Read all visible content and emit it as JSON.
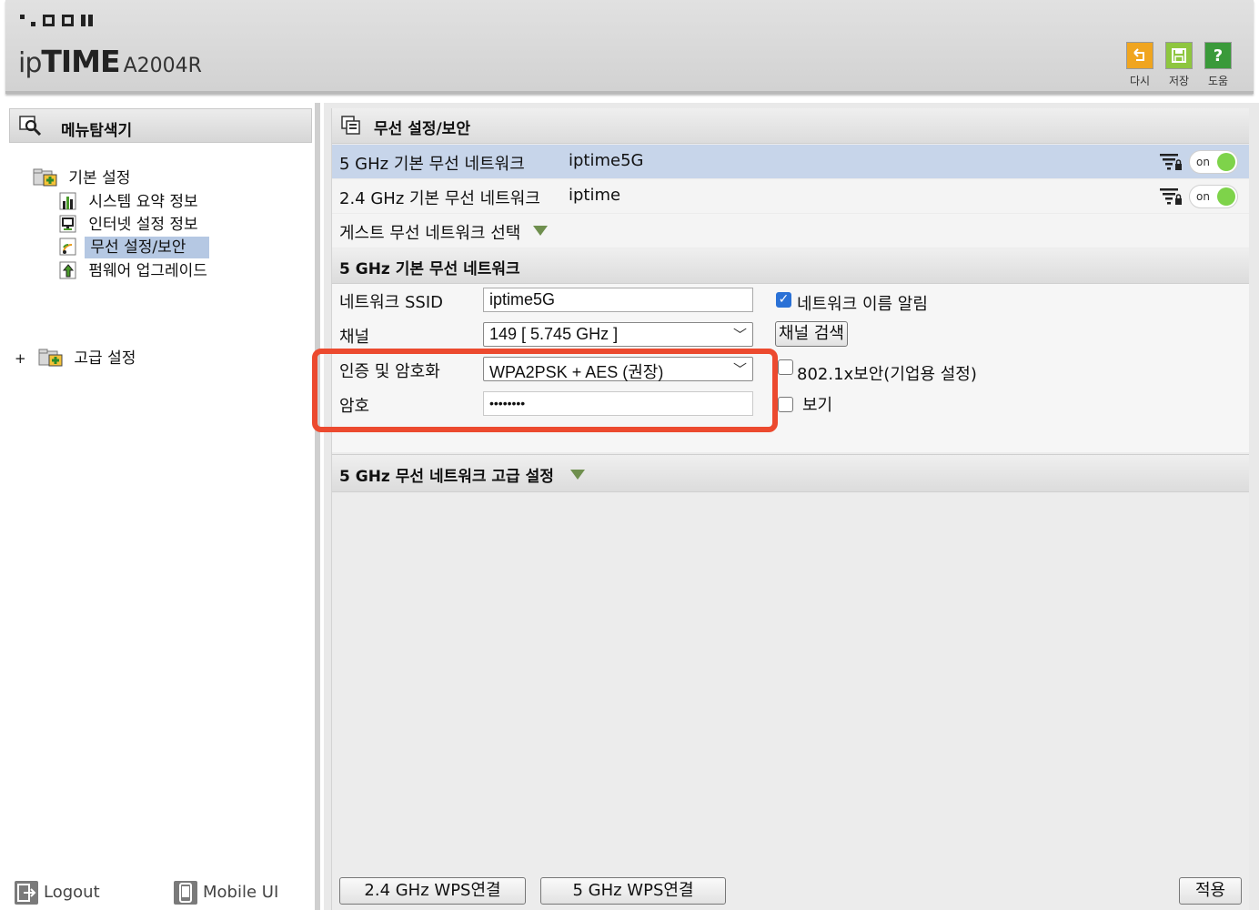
{
  "header": {
    "logo_word": "ipTIME",
    "model": "A2004R",
    "buttons": [
      {
        "label": "다시",
        "icon": "undo-icon"
      },
      {
        "label": "저장",
        "icon": "save-icon"
      },
      {
        "label": "도움",
        "icon": "help-icon"
      }
    ],
    "colors": {
      "undo": "#f0a51f",
      "save": "#8ec63f",
      "help": "#3a9a3a"
    }
  },
  "sidebar": {
    "title": "메뉴탐색기",
    "basic": {
      "label": "기본 설정",
      "items": [
        {
          "label": "시스템 요약 정보",
          "icon": "chart-icon"
        },
        {
          "label": "인터넷 설정 정보",
          "icon": "monitor-icon"
        },
        {
          "label": "무선 설정/보안",
          "icon": "wireless-icon",
          "selected": true
        },
        {
          "label": "펌웨어 업그레이드",
          "icon": "upgrade-icon"
        }
      ]
    },
    "advanced": {
      "expander": "+",
      "label": "고급 설정"
    },
    "logout_label": "Logout",
    "mobile_label": "Mobile UI"
  },
  "main": {
    "title": "무선 설정/보안",
    "networks": [
      {
        "name": "5 GHz 기본 무선 네트워크",
        "ssid": "iptime5G",
        "toggle": "on",
        "selected": true
      },
      {
        "name": "2.4 GHz 기본 무선 네트워크",
        "ssid": "iptime",
        "toggle": "on",
        "selected": false
      }
    ],
    "guest_label": "게스트 무선 네트워크 선택",
    "section_title": "5 GHz 기본 무선 네트워크",
    "fields": {
      "ssid_label": "네트워크 SSID",
      "ssid_value": "iptime5G",
      "broadcast_label": "네트워크 이름 알림",
      "broadcast_checked": true,
      "channel_label": "채널",
      "channel_value": "149 [ 5.745 GHz ]",
      "channel_scan_label": "채널 검색",
      "auth_label": "인증 및 암호화",
      "auth_value": "WPA2PSK + AES (권장)",
      "dot1x_label": "802.1x보안(기업용 설정)",
      "dot1x_checked": false,
      "password_label": "암호",
      "password_value": "••••••••",
      "show_label": "보기",
      "show_checked": false
    },
    "advanced_title": "5 GHz 무선 네트워크 고급 설정",
    "buttons": {
      "wps24": "2.4 GHz WPS연결",
      "wps5": "5 GHz WPS연결",
      "apply": "적용"
    },
    "highlight_color": "#ec4a2f"
  }
}
